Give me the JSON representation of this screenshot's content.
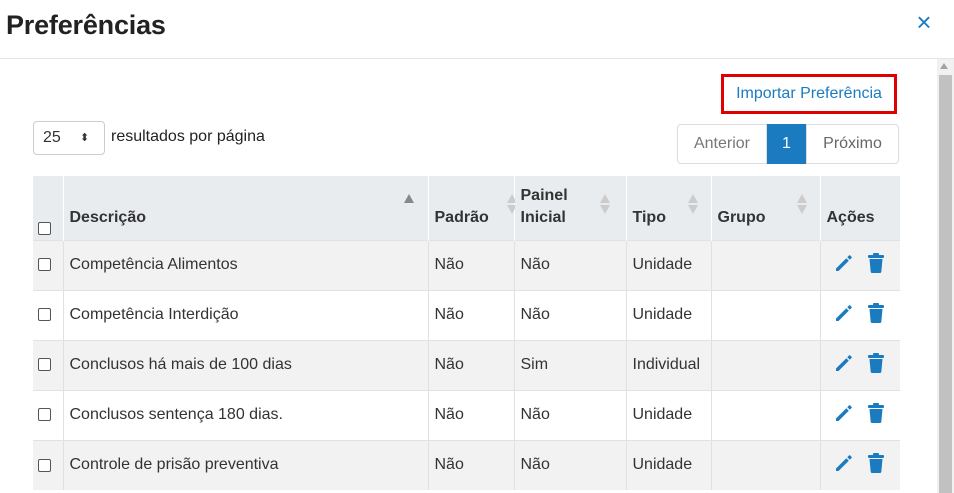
{
  "modal": {
    "title": "Preferências",
    "close_glyph": "×"
  },
  "toolbar": {
    "import_label": "Importar Preferência",
    "page_size": "25",
    "page_size_caret": "⬍",
    "per_page_label": "resultados por página"
  },
  "pagination": {
    "prev_label": "Anterior",
    "current_page": "1",
    "next_label": "Próximo"
  },
  "table": {
    "columns": [
      "Descrição",
      "Padrão",
      "Painel Inicial",
      "Tipo",
      "Grupo",
      "Ações"
    ],
    "sorted_column": "Descrição",
    "rows": [
      {
        "descricao": "Competência Alimentos",
        "padrao": "Não",
        "painel": "Não",
        "tipo": "Unidade",
        "grupo": ""
      },
      {
        "descricao": "Competência Interdição",
        "padrao": "Não",
        "painel": "Não",
        "tipo": "Unidade",
        "grupo": ""
      },
      {
        "descricao": "Conclusos há mais de 100 dias",
        "padrao": "Não",
        "painel": "Sim",
        "tipo": "Individual",
        "grupo": ""
      },
      {
        "descricao": "Conclusos sentença 180 dias.",
        "padrao": "Não",
        "painel": "Não",
        "tipo": "Unidade",
        "grupo": ""
      },
      {
        "descricao": "Controle de prisão preventiva",
        "padrao": "Não",
        "painel": "Não",
        "tipo": "Unidade",
        "grupo": ""
      }
    ]
  },
  "icons": {
    "edit": "pencil-icon",
    "delete": "trash-icon",
    "close": "close-icon"
  },
  "colors": {
    "accent": "#1a7bc0",
    "highlight_border": "#e00000",
    "header_bg": "#e9ecef",
    "row_stripe": "#f2f2f2"
  }
}
